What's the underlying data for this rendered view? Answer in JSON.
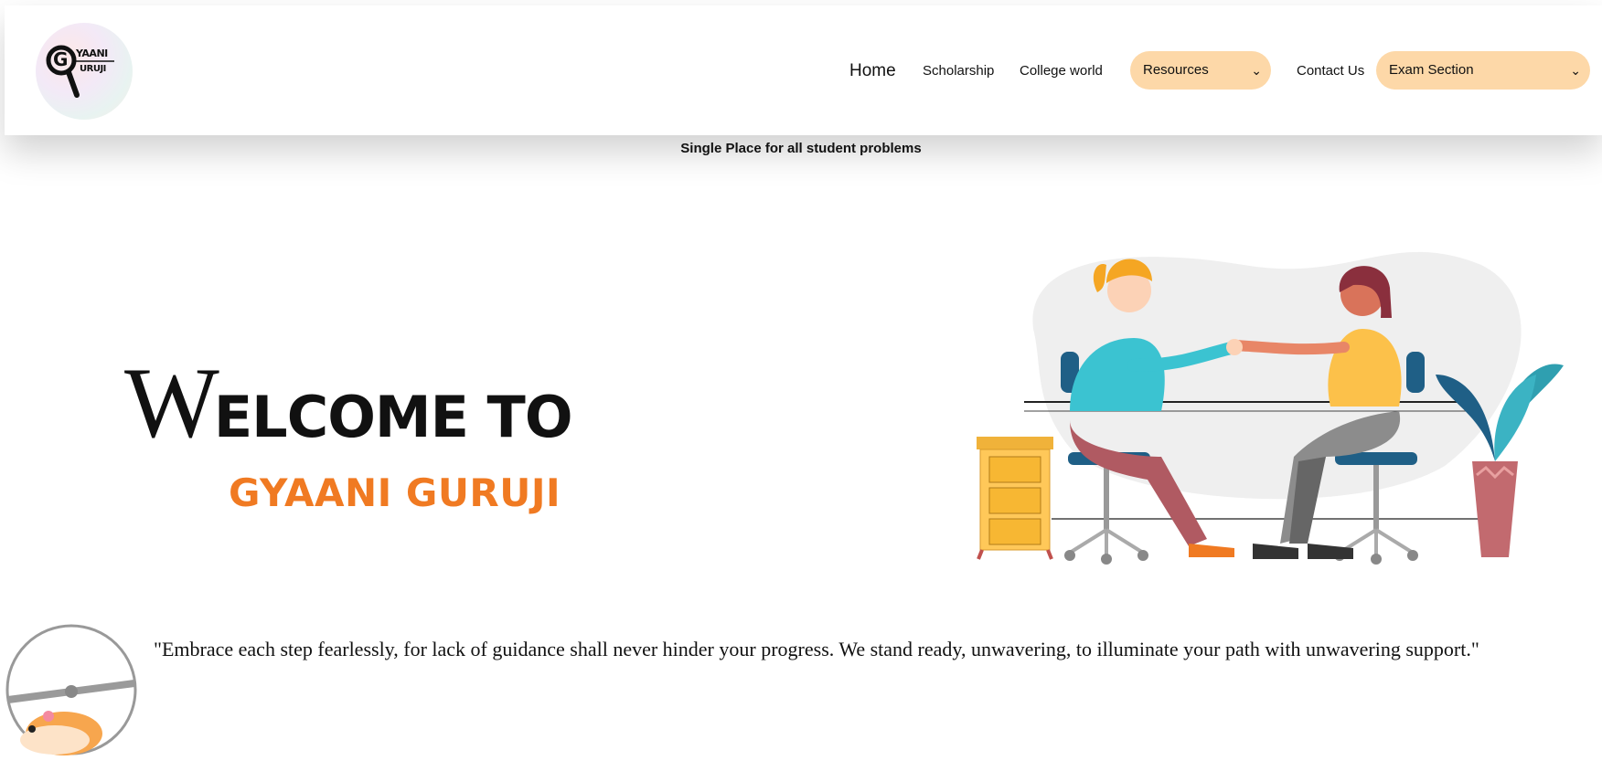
{
  "header": {
    "logo": {
      "line1": "YAANI",
      "line2": "URUJI",
      "initial": "G"
    },
    "nav": {
      "home": "Home",
      "scholarship": "Scholarship",
      "college_world": "College world",
      "resources": "Resources",
      "contact": "Contact Us",
      "exam_section": "Exam Section"
    }
  },
  "tagline": "Single Place for all student problems",
  "hero": {
    "welcome_first": "W",
    "welcome_rest": "ELCOME TO",
    "brand": "GYAANI GURUJI"
  },
  "quote": "\"Embrace each step fearlessly, for lack of guidance shall never hinder your progress. We stand ready, unwavering, to illuminate your path with unwavering support.\"",
  "colors": {
    "accent_orange": "#f07a22",
    "pill_bg": "#fdd8a8"
  },
  "icons": {
    "select_arrow": "chevron-down-icon"
  }
}
